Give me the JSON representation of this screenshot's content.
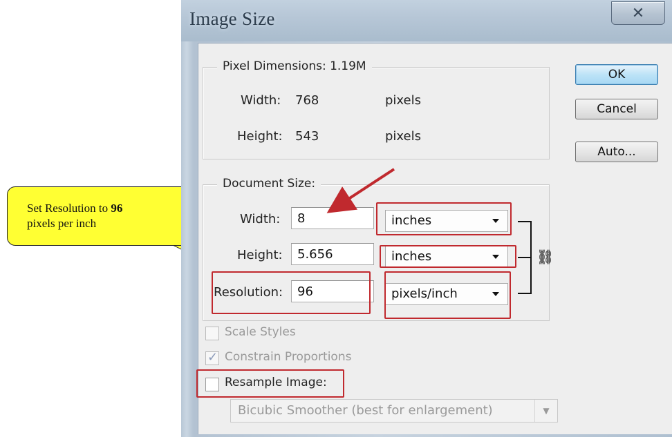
{
  "window": {
    "title": "Image Size",
    "close_glyph": "✕"
  },
  "pixel_dimensions": {
    "title": "Pixel Dimensions:",
    "size": "1.19M",
    "width_label": "Width:",
    "width_value": "768",
    "width_unit": "pixels",
    "height_label": "Height:",
    "height_value": "543",
    "height_unit": "pixels"
  },
  "document_size": {
    "title": "Document Size:",
    "width_label": "Width:",
    "width_value": "8",
    "width_unit": "inches",
    "height_label": "Height:",
    "height_value": "5.656",
    "height_unit": "inches",
    "resolution_label": "Resolution:",
    "resolution_value": "96",
    "resolution_unit": "pixels/inch",
    "chain_icon": "link-icon"
  },
  "buttons": {
    "ok": "OK",
    "cancel": "Cancel",
    "auto": "Auto..."
  },
  "options": {
    "scale_styles": {
      "label": "Scale Styles",
      "checked": false,
      "enabled": false
    },
    "constrain_proportions": {
      "label": "Constrain Proportions",
      "checked": true,
      "enabled": false
    },
    "resample_image": {
      "label": "Resample Image:",
      "checked": false,
      "enabled": true
    },
    "resample_method": "Bicubic Smoother (best for enlargement)"
  },
  "callout": {
    "text_prefix": "Set Resolution to ",
    "text_bold": "96",
    "text_suffix": "pixels per inch"
  },
  "colors": {
    "highlight_red": "#c0292e",
    "callout_yellow": "#ffff33",
    "arrow_red": "#c0292e"
  }
}
